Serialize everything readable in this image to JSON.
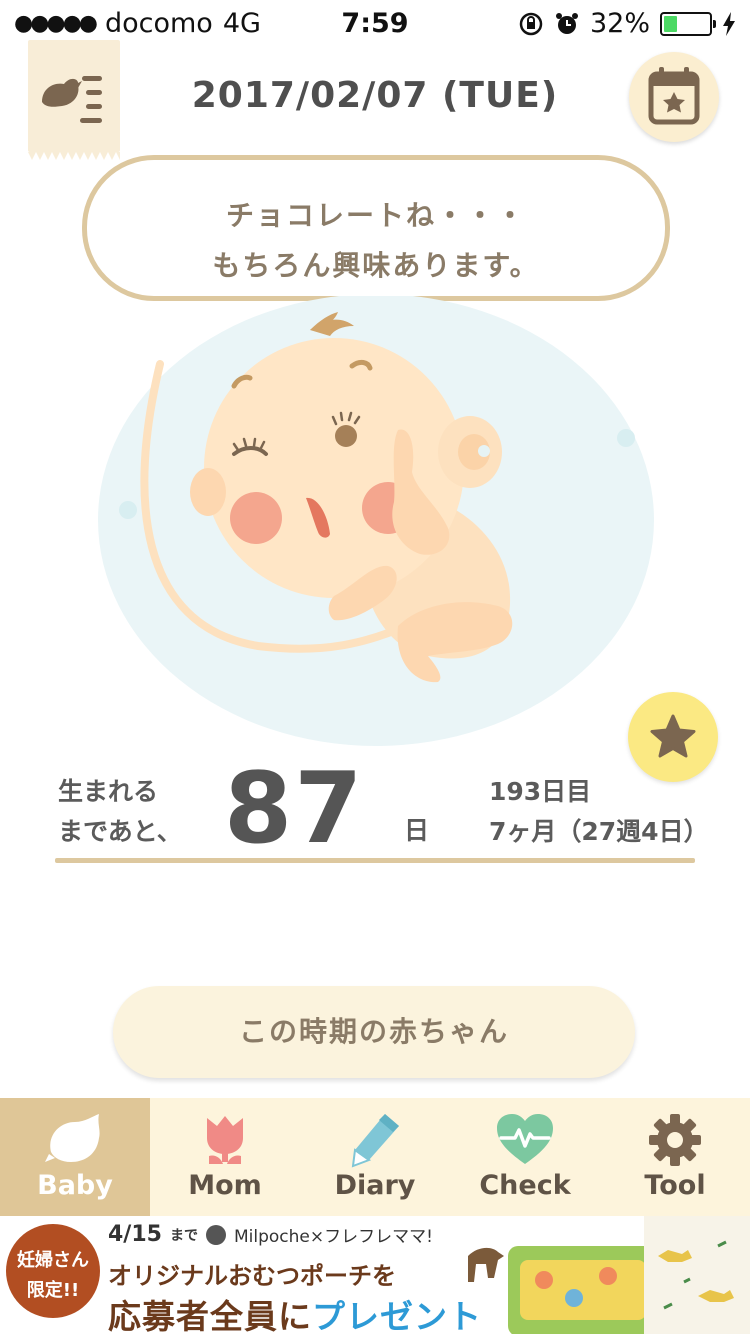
{
  "status_bar": {
    "signal": "●●●●●",
    "carrier": "docomo",
    "network": "4G",
    "time": "7:59",
    "battery_percent": "32%",
    "battery_level": 0.32,
    "battery_color": "#4cd964",
    "icons": [
      "orientation-lock-icon",
      "alarm-icon",
      "charging-bolt-icon"
    ]
  },
  "header": {
    "date": "2017/02/07 (TUE)",
    "menu_icon": "bird-list-icon",
    "calendar_icon": "calendar-star-icon"
  },
  "speech": {
    "line1": "チョコレートね・・・",
    "line2": "もちろん興味あります。"
  },
  "countdown": {
    "label_line1": "生まれる",
    "label_line2": "まであと、",
    "days_left": "87",
    "unit": "日",
    "day_count": "193日目",
    "month_week": "7ヶ月（27週4日）"
  },
  "period_button": {
    "label": "この時期の赤ちゃん"
  },
  "tabs": [
    {
      "label": "Baby",
      "icon": "bird-icon",
      "active": true
    },
    {
      "label": "Mom",
      "icon": "tulip-icon",
      "active": false
    },
    {
      "label": "Diary",
      "icon": "pencil-icon",
      "active": false
    },
    {
      "label": "Check",
      "icon": "heart-pulse-icon",
      "active": false
    },
    {
      "label": "Tool",
      "icon": "gear-icon",
      "active": false
    }
  ],
  "ad": {
    "badge_line1": "妊婦さん",
    "badge_line2": "限定!!",
    "date": "4/15",
    "date_suffix": "まで",
    "brand": "Milpoche×フレフレママ!",
    "line2": "オリジナルおむつポーチを",
    "line3_prefix": "応募者全員に",
    "line3_highlight": "プレゼント"
  },
  "colors": {
    "accent_gold": "#ddc89f",
    "tab_active": "#dfc697",
    "tab_bar": "#fdf4dc",
    "favorite_yellow": "#fbe983",
    "ad_highlight": "#2d9ad6"
  }
}
